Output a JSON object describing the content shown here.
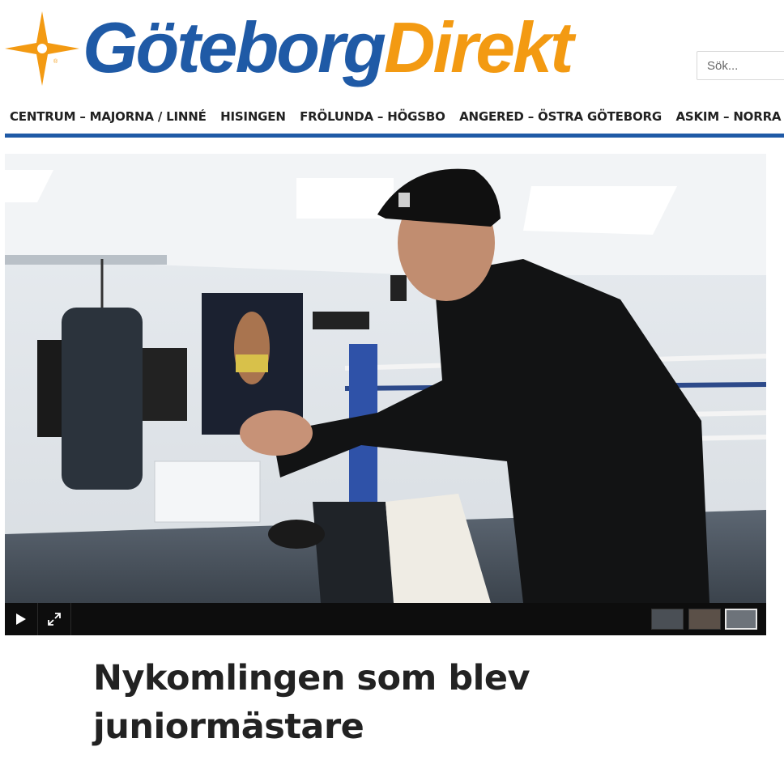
{
  "brand": {
    "name_part1": "Göteborg",
    "name_part2": "Direkt",
    "color_blue": "#1f5aa6",
    "color_orange": "#f39a12",
    "icon": "compass-star-icon"
  },
  "search": {
    "placeholder": "Sök..."
  },
  "nav": {
    "items": [
      "CENTRUM – MAJORNA / LINNÉ",
      "HISINGEN",
      "FRÖLUNDA – HÖGSBO",
      "ANGERED – ÖSTRA GÖTEBORG",
      "ASKIM – NORRA HALL"
    ]
  },
  "media": {
    "play_icon": "play-icon",
    "fullscreen_icon": "expand-icon",
    "thumbnail_count": 3,
    "active_thumbnail": 3
  },
  "article": {
    "headline": "Nykomlingen som blev juniormästare"
  }
}
